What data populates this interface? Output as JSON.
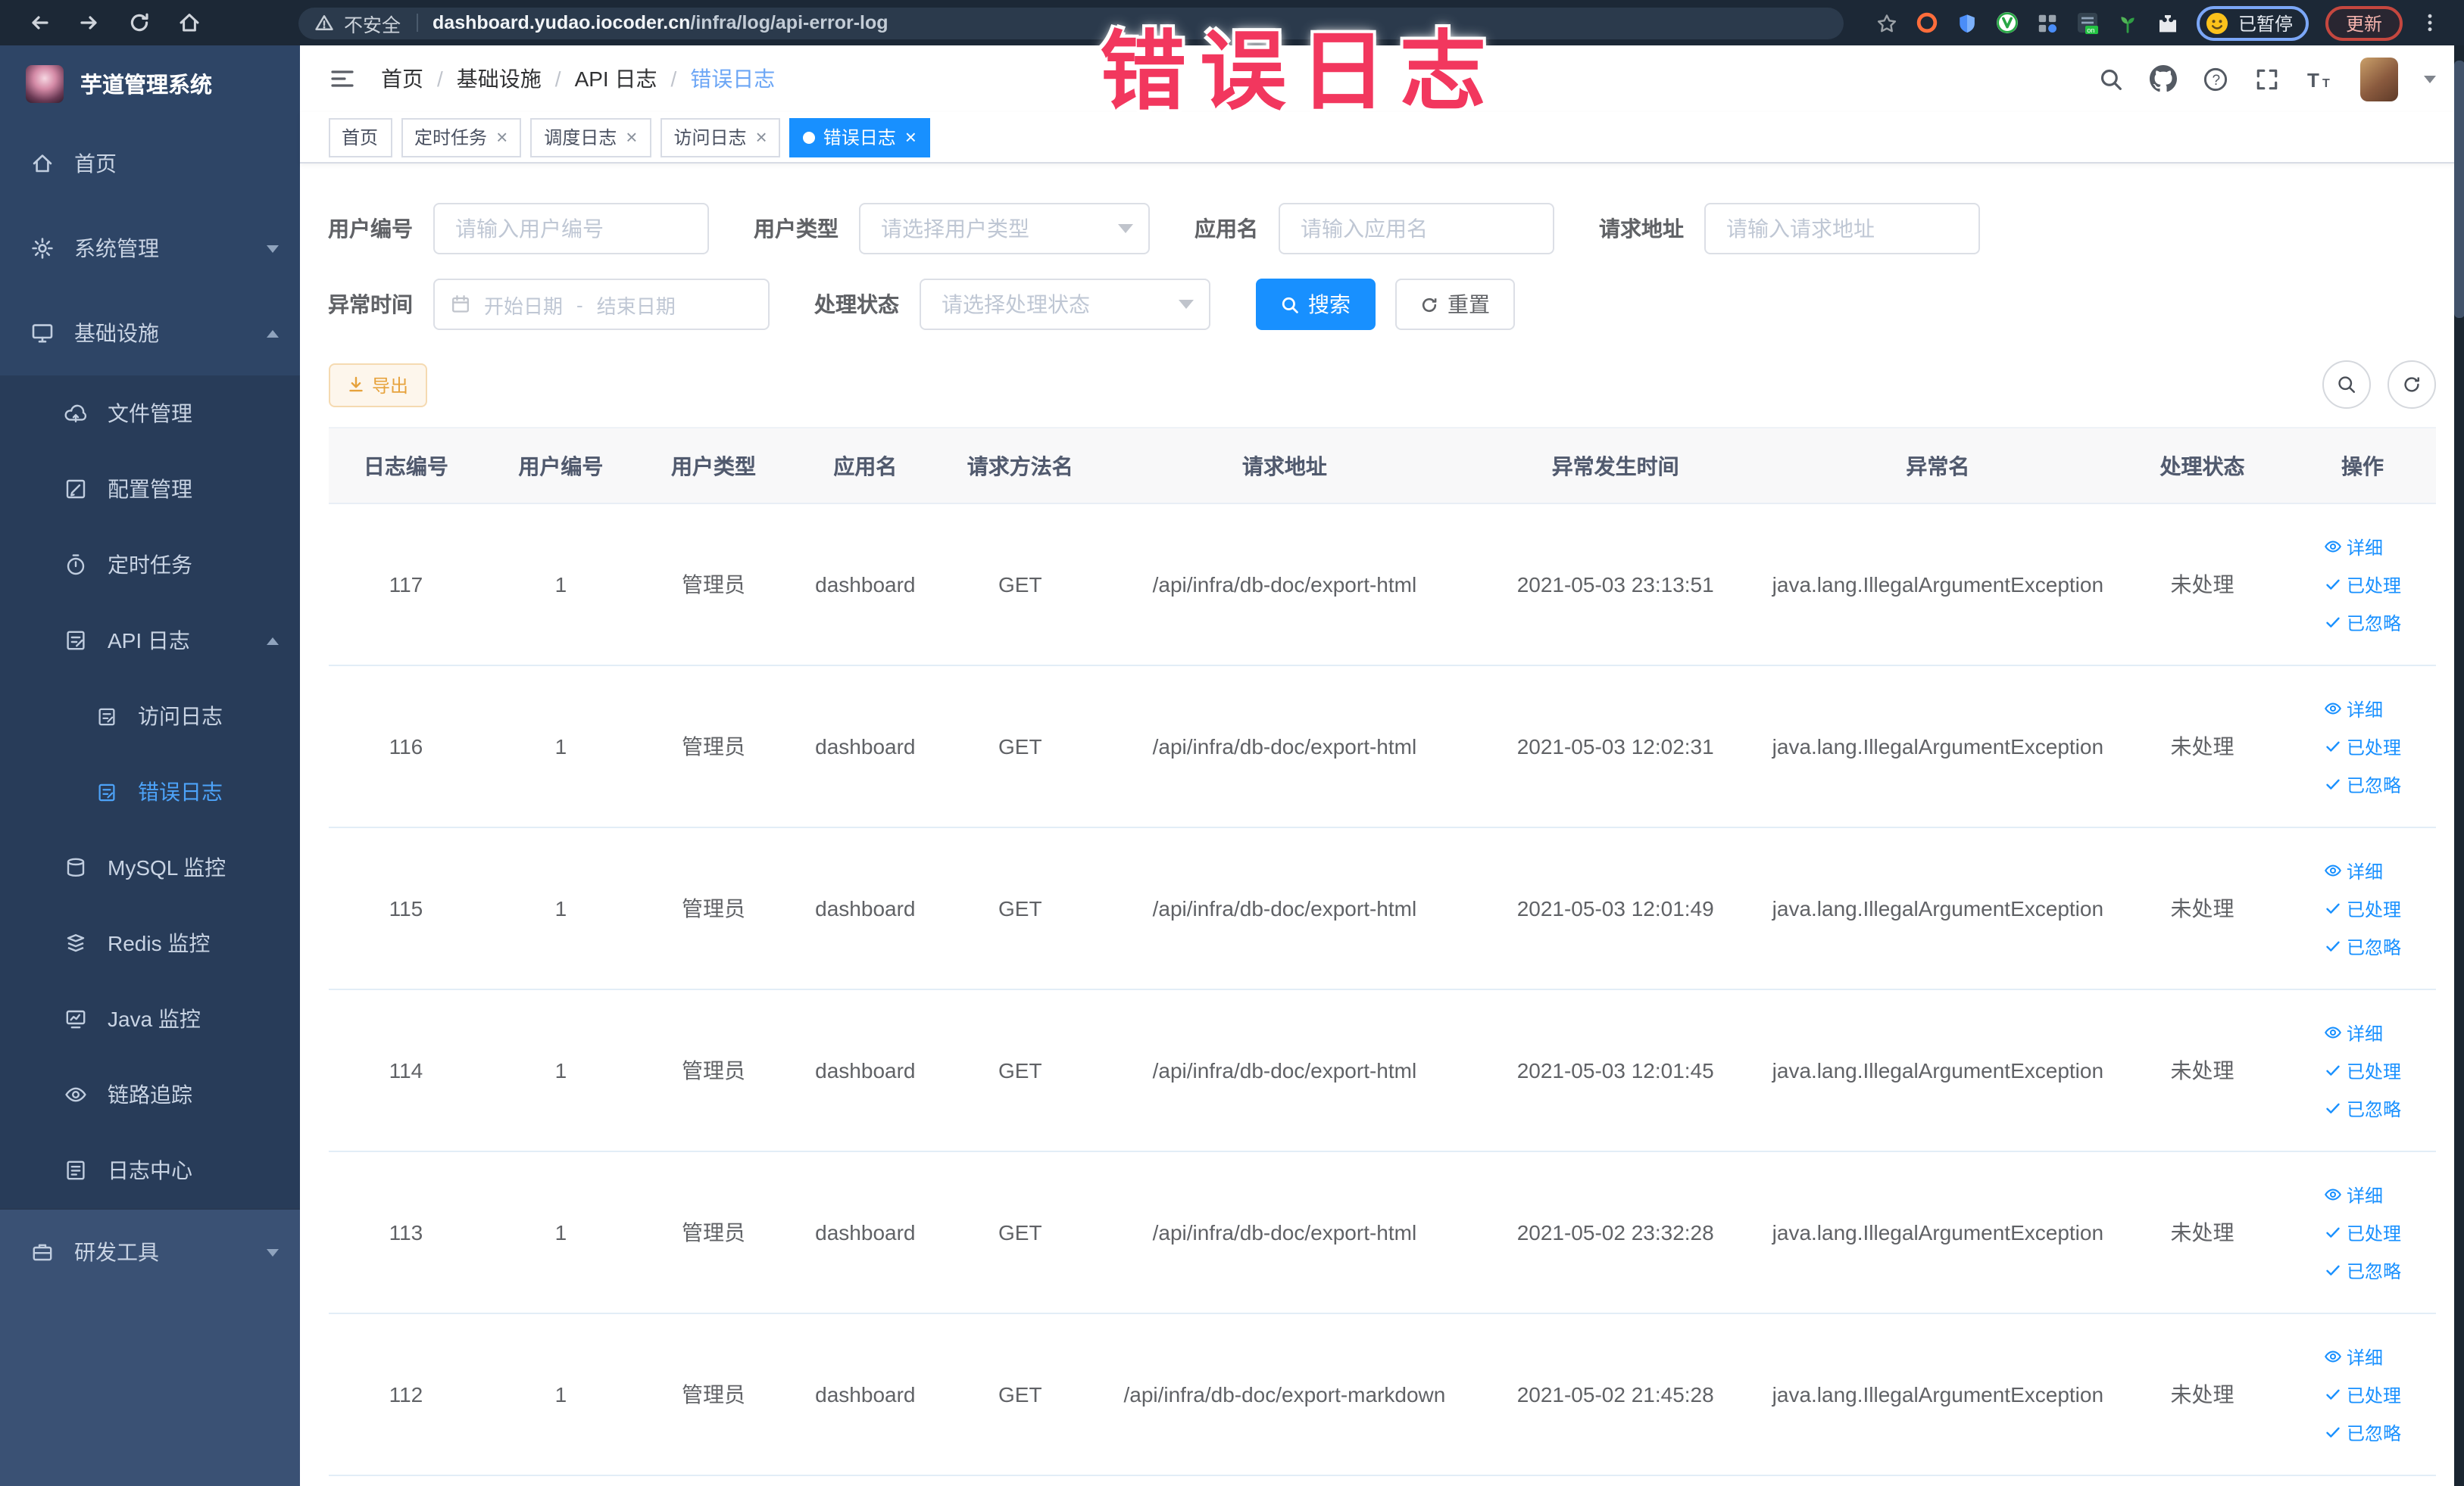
{
  "overlay": {
    "stamp": "错误日志"
  },
  "browser": {
    "security_label": "不安全",
    "url_domain": "dashboard.yudao.iocoder.cn",
    "url_path": "/infra/log/api-error-log",
    "paused_label": "已暂停",
    "update_label": "更新"
  },
  "sidebar": {
    "app_title": "芋道管理系统",
    "items": [
      {
        "label": "首页"
      },
      {
        "label": "系统管理"
      },
      {
        "label": "基础设施"
      },
      {
        "label": "文件管理"
      },
      {
        "label": "配置管理"
      },
      {
        "label": "定时任务"
      },
      {
        "label": "API 日志"
      },
      {
        "label": "访问日志"
      },
      {
        "label": "错误日志"
      },
      {
        "label": "MySQL 监控"
      },
      {
        "label": "Redis 监控"
      },
      {
        "label": "Java 监控"
      },
      {
        "label": "链路追踪"
      },
      {
        "label": "日志中心"
      },
      {
        "label": "研发工具"
      }
    ]
  },
  "header": {
    "breadcrumb": [
      "首页",
      "基础设施",
      "API 日志",
      "错误日志"
    ],
    "separator": "/"
  },
  "tabs": {
    "close_glyph": "×",
    "items": [
      {
        "label": "首页"
      },
      {
        "label": "定时任务"
      },
      {
        "label": "调度日志"
      },
      {
        "label": "访问日志"
      },
      {
        "label": "错误日志"
      }
    ]
  },
  "filters": {
    "user_id": {
      "label": "用户编号",
      "placeholder": "请输入用户编号"
    },
    "user_type": {
      "label": "用户类型",
      "placeholder": "请选择用户类型"
    },
    "app_name": {
      "label": "应用名",
      "placeholder": "请输入应用名"
    },
    "request_url": {
      "label": "请求地址",
      "placeholder": "请输入请求地址"
    },
    "exception_time": {
      "label": "异常时间",
      "start_placeholder": "开始日期",
      "separator": "-",
      "end_placeholder": "结束日期"
    },
    "process_status": {
      "label": "处理状态",
      "placeholder": "请选择处理状态"
    },
    "search_label": "搜索",
    "reset_label": "重置"
  },
  "toolbar": {
    "export_label": "导出"
  },
  "table": {
    "columns": [
      "日志编号",
      "用户编号",
      "用户类型",
      "应用名",
      "请求方法名",
      "请求地址",
      "异常发生时间",
      "异常名",
      "处理状态",
      "操作"
    ],
    "action_labels": {
      "detail": "详细",
      "processed": "已处理",
      "ignored": "已忽略"
    },
    "rows": [
      {
        "id": "117",
        "user_id": "1",
        "user_type": "管理员",
        "app": "dashboard",
        "method": "GET",
        "url": "/api/infra/db-doc/export-html",
        "time": "2021-05-03 23:13:51",
        "exception": "java.lang.IllegalArgumentException",
        "status": "未处理"
      },
      {
        "id": "116",
        "user_id": "1",
        "user_type": "管理员",
        "app": "dashboard",
        "method": "GET",
        "url": "/api/infra/db-doc/export-html",
        "time": "2021-05-03 12:02:31",
        "exception": "java.lang.IllegalArgumentException",
        "status": "未处理"
      },
      {
        "id": "115",
        "user_id": "1",
        "user_type": "管理员",
        "app": "dashboard",
        "method": "GET",
        "url": "/api/infra/db-doc/export-html",
        "time": "2021-05-03 12:01:49",
        "exception": "java.lang.IllegalArgumentException",
        "status": "未处理"
      },
      {
        "id": "114",
        "user_id": "1",
        "user_type": "管理员",
        "app": "dashboard",
        "method": "GET",
        "url": "/api/infra/db-doc/export-html",
        "time": "2021-05-03 12:01:45",
        "exception": "java.lang.IllegalArgumentException",
        "status": "未处理"
      },
      {
        "id": "113",
        "user_id": "1",
        "user_type": "管理员",
        "app": "dashboard",
        "method": "GET",
        "url": "/api/infra/db-doc/export-html",
        "time": "2021-05-02 23:32:28",
        "exception": "java.lang.IllegalArgumentException",
        "status": "未处理"
      },
      {
        "id": "112",
        "user_id": "1",
        "user_type": "管理员",
        "app": "dashboard",
        "method": "GET",
        "url": "/api/infra/db-doc/export-markdown",
        "time": "2021-05-02 21:45:28",
        "exception": "java.lang.IllegalArgumentException",
        "status": "未处理"
      }
    ]
  },
  "colors": {
    "primary": "#1890ff",
    "warning": "#e6a23c",
    "stamp": "#f2375e",
    "tab_active": "#1890ff"
  }
}
